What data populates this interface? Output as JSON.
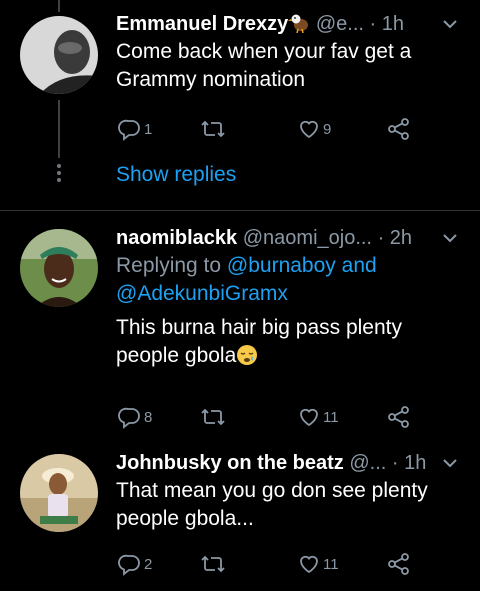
{
  "tweets": [
    {
      "name": "Emmanuel Drexzy",
      "name_emoji": "eagle",
      "handle": "@e...",
      "dot": "·",
      "time": "1h",
      "text": "Come back when your fav get a Grammy nomination",
      "reply_count": "1",
      "retweet_count": "",
      "like_count": "9"
    },
    {
      "name": "naomiblackk",
      "handle": "@naomi_ojo...",
      "dot": "·",
      "time": "2h",
      "replying_prefix": "Replying to",
      "replying_mention_1": "@burnaboy",
      "replying_and": "and",
      "replying_mention_2": "@AdekunbiGramx",
      "text": "This burna hair big pass plenty people gbola",
      "text_emoji": "sleepy-face",
      "reply_count": "8",
      "retweet_count": "",
      "like_count": "11"
    },
    {
      "name": "Johnbusky on the beatz",
      "handle": "@...",
      "dot": "·",
      "time": "1h",
      "text": "That mean you go don see plenty people gbola...",
      "reply_count": "2",
      "retweet_count": "",
      "like_count": "11"
    }
  ],
  "show_replies": "Show replies",
  "colors": {
    "background": "#000000",
    "secondary": "#8b98a5",
    "link": "#1da1f2",
    "divider": "#2f3336"
  },
  "icons": [
    "reply-icon",
    "retweet-icon",
    "like-icon",
    "share-icon",
    "chevron-down-icon"
  ]
}
